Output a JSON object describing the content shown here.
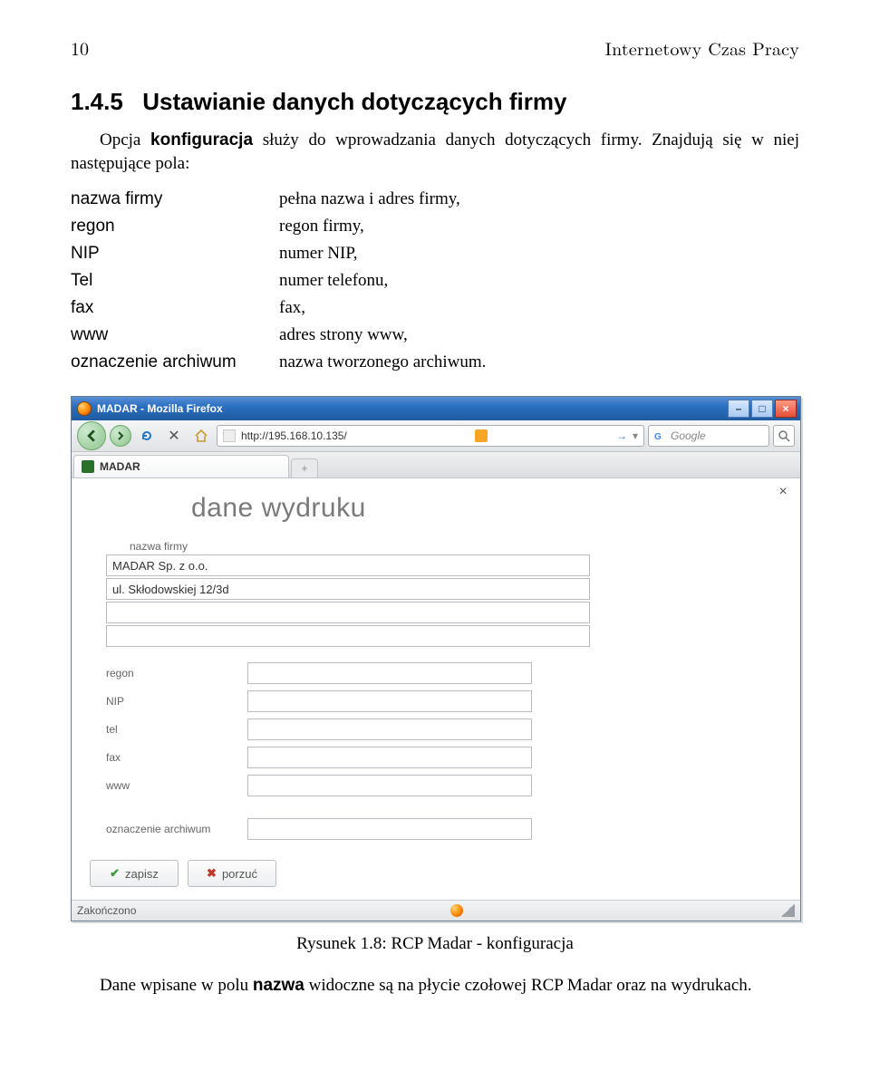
{
  "page": {
    "number": "10",
    "running_title": "Internetowy Czas Pracy"
  },
  "section": {
    "number": "1.4.5",
    "title": "Ustawianie danych dotyczących firmy"
  },
  "para1_a": "Opcja ",
  "para1_bold": "konfiguracja",
  "para1_b": " służy do wprowadzania danych dotyczących firmy. Znajdują się w niej następujące pola:",
  "defs": [
    {
      "term": "nazwa firmy",
      "desc": "pełna nazwa i adres firmy,"
    },
    {
      "term": "regon",
      "desc": "regon firmy,"
    },
    {
      "term": "NIP",
      "desc": "numer NIP,"
    },
    {
      "term": "Tel",
      "desc": "numer telefonu,"
    },
    {
      "term": "fax",
      "desc": "fax,"
    },
    {
      "term": "www",
      "desc": "adres strony www,"
    },
    {
      "term": "oznaczenie archiwum",
      "desc": "nazwa tworzonego archiwum."
    }
  ],
  "browser": {
    "window_title": "MADAR - Mozilla Firefox",
    "url": "http://195.168.10.135/",
    "search_placeholder": "Google",
    "tab_title": "MADAR",
    "status": "Zakończono"
  },
  "form": {
    "heading": "dane wydruku",
    "label_nazwa": "nazwa firmy",
    "val_name": "MADAR Sp. z o.o.",
    "val_addr": "ul. Skłodowskiej 12/3d",
    "rows": [
      "regon",
      "NIP",
      "tel",
      "fax",
      "www"
    ],
    "label_archiwum": "oznaczenie archiwum",
    "btn_save": "zapisz",
    "btn_cancel": "porzuć"
  },
  "caption": "Rysunek 1.8: RCP Madar - konfiguracja",
  "para2_a": "Dane wpisane w polu ",
  "para2_bold": "nazwa",
  "para2_b": " widoczne są na płycie czołowej RCP Madar oraz na wydrukach."
}
